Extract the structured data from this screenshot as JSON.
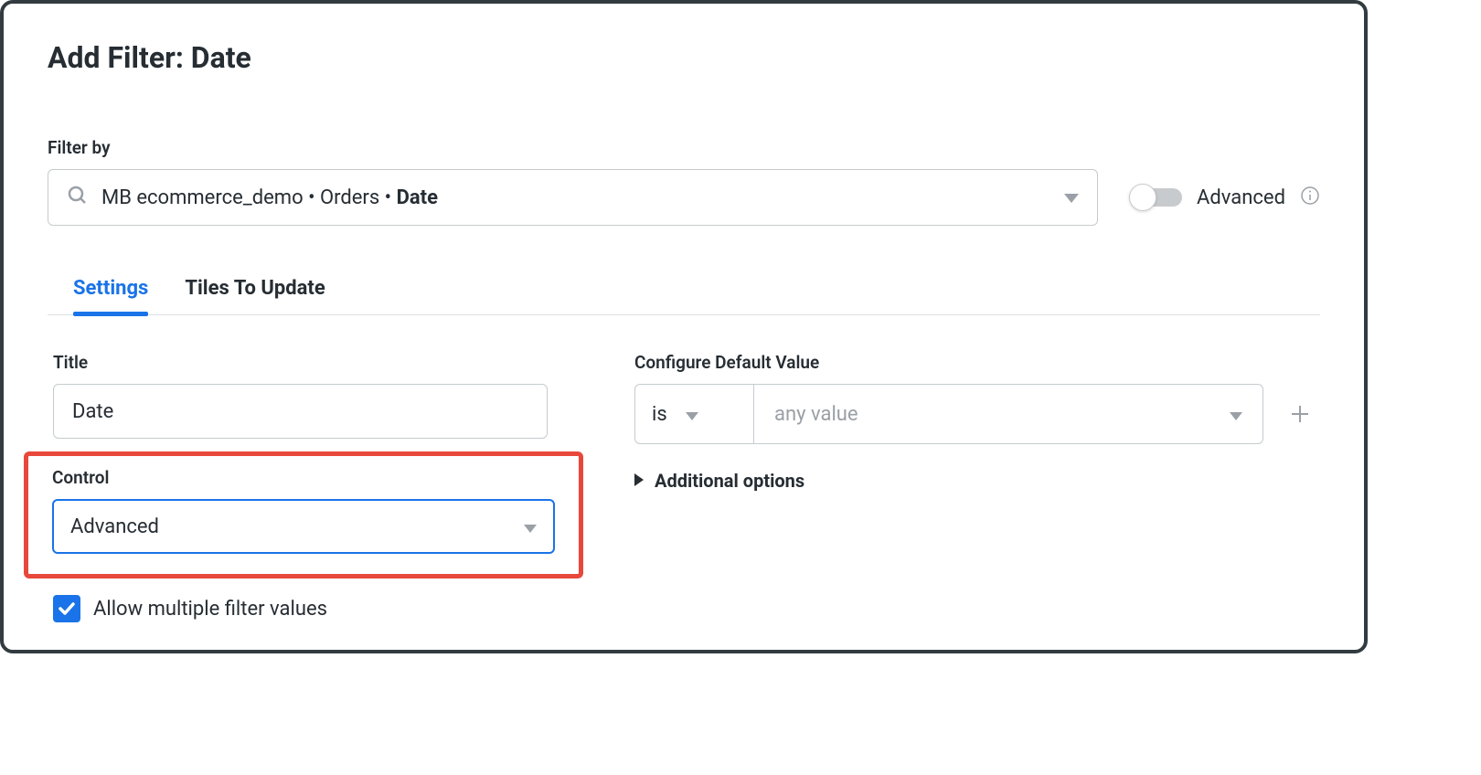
{
  "dialog": {
    "title": "Add Filter: Date"
  },
  "filter_by": {
    "label": "Filter by",
    "path_prefix": "MB ecommerce_demo • Orders • ",
    "path_last": "Date"
  },
  "advanced_toggle": {
    "label": "Advanced",
    "enabled": false
  },
  "tabs": {
    "settings": "Settings",
    "tiles": "Tiles To Update",
    "active": "settings"
  },
  "settings": {
    "title": {
      "label": "Title",
      "value": "Date"
    },
    "control": {
      "label": "Control",
      "value": "Advanced"
    },
    "allow_multiple": {
      "label": "Allow multiple filter values",
      "checked": true
    }
  },
  "config": {
    "label": "Configure Default Value",
    "condition": "is",
    "value_placeholder": "any value",
    "additional_options": "Additional options"
  }
}
